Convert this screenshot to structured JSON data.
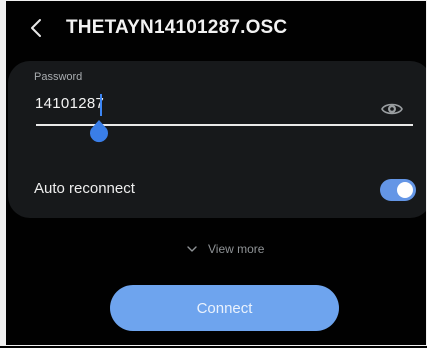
{
  "header": {
    "back_icon": "chevron-left-icon",
    "title": "THETAYN14101287.OSC"
  },
  "password": {
    "label": "Password",
    "value": "14101287",
    "visibility_icon": "eye-icon"
  },
  "auto_reconnect": {
    "label": "Auto reconnect",
    "enabled": true
  },
  "view_more": {
    "icon": "chevron-down-icon",
    "label": "View more"
  },
  "connect_button": {
    "label": "Connect"
  },
  "colors": {
    "background": "#010101",
    "card": "#17191b",
    "accent": "#3d86f5",
    "toggle_on": "#6496e6",
    "button": "#6ea4ee"
  }
}
